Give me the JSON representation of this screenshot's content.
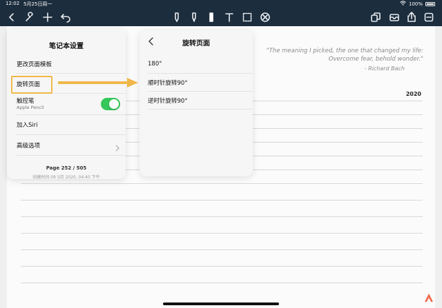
{
  "status_bar": {
    "time": "12:02",
    "date": "5月25日周一",
    "battery": "100%"
  },
  "toolbar": {
    "left_icons": [
      "back-chevron-icon",
      "wrench-icon",
      "plus-icon",
      "undo-icon"
    ],
    "center_icons": [
      "pen-icon",
      "highlighter-icon",
      "eraser-icon",
      "text-tool-icon",
      "lasso-select-icon",
      "shape-cancel-icon"
    ],
    "right_icons": [
      "page-layers-icon",
      "tray-icon",
      "share-icon",
      "more-icon"
    ],
    "colors": {
      "bar": "#1c2d3d",
      "icon": "#e8ecf0"
    }
  },
  "notebook_settings": {
    "title": "笔记本设置",
    "items": [
      {
        "label": "更改页面模板"
      },
      {
        "label": "旋转页面"
      },
      {
        "label": "触控笔",
        "sublabel": "Apple Pencil",
        "toggle_on": true
      },
      {
        "label": "加入Siri"
      },
      {
        "label": "高级选项"
      }
    ],
    "page_info": "Page 252 / 505",
    "created": "创建时间 09 5月 2020, 04:40 下午",
    "toggle_color": "#34c759"
  },
  "rotate_page": {
    "title": "旋转页面",
    "items": [
      {
        "label": "180°"
      },
      {
        "label": "顺时针旋转90°"
      },
      {
        "label": "逆时针旋转90°"
      }
    ]
  },
  "page": {
    "quote": "\"The meaning I picked, the one that changed my life: Overcome fear, behold wonder.\"",
    "author": "- Richard Bach",
    "year": "2020"
  },
  "annotation": {
    "highlight_color": "#f0b84a",
    "target": "旋转页面"
  }
}
